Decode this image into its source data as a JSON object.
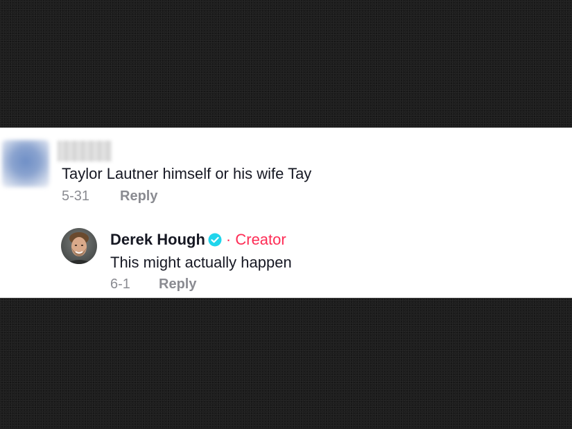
{
  "comment": {
    "text": "Taylor Lautner himself or his wife Tay",
    "date": "5-31",
    "reply_label": "Reply"
  },
  "reply": {
    "author": "Derek Hough",
    "tag": "· Creator",
    "text": "This might actually happen",
    "date": "6-1",
    "reply_label": "Reply"
  },
  "colors": {
    "creator_accent": "#fe2c55",
    "verified_badge": "#20d5ec",
    "meta_gray": "#8a8b91"
  }
}
